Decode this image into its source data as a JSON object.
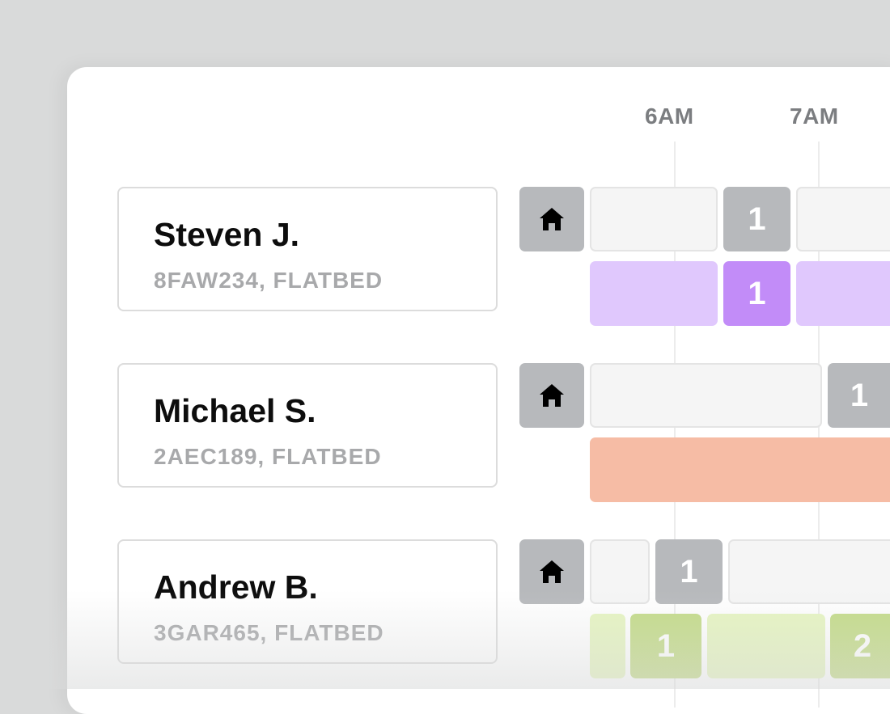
{
  "timeline": {
    "hours": [
      "6AM",
      "7AM"
    ]
  },
  "drivers": [
    {
      "name": "Steven J.",
      "vehicle": "8FAW234, FLATBED",
      "stops_row": [
        "1"
      ],
      "route_row": [
        "1"
      ],
      "route_color": "#e0c8fd",
      "route_accent": "#c28cf8"
    },
    {
      "name": "Michael S.",
      "vehicle": "2AEC189, FLATBED",
      "stops_row": [
        "1"
      ],
      "route_row": [],
      "route_color": "#f6bca5"
    },
    {
      "name": "Andrew B.",
      "vehicle": "3GAR465, FLATBED",
      "stops_row": [
        "1"
      ],
      "route_row": [
        "1",
        "2"
      ],
      "route_color": "#e6f5c1",
      "route_accent": "#c3db87"
    }
  ],
  "icons": {
    "home": "home-icon"
  }
}
